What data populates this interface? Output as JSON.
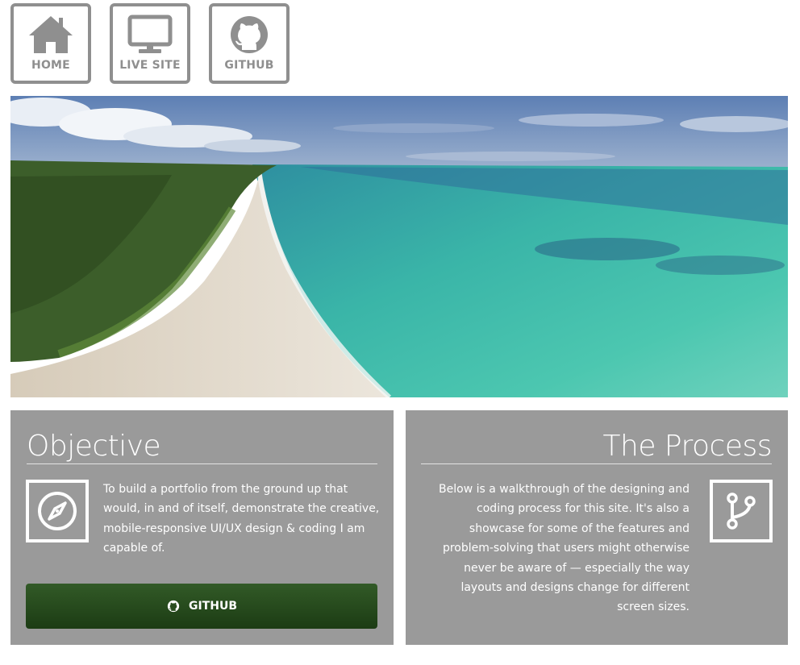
{
  "nav": {
    "home_label": "HOME",
    "live_label": "LIVE SITE",
    "github_label": "GITHUB"
  },
  "hero": {
    "image": "aerial-beach-photo"
  },
  "objective": {
    "title": "Objective",
    "text": "To build a portfolio from the ground up that would, in and of itself, demonstrate the creative, mobile-responsive UI/UX design & coding I am capable of.",
    "button_label": "GITHUB",
    "icon": "compass-icon"
  },
  "process": {
    "title": "The Process",
    "text": "Below is a walkthrough of the designing and coding process for this site. It's also a showcase for some of the features and problem-solving that users might otherwise never be aware of — especially the way layouts and designs change for different screen sizes.",
    "icon": "git-branch-icon"
  },
  "colors": {
    "nav_border": "#8f8f8f",
    "panel_bg": "#9a9a9a",
    "button_green": "#2a4d20"
  }
}
